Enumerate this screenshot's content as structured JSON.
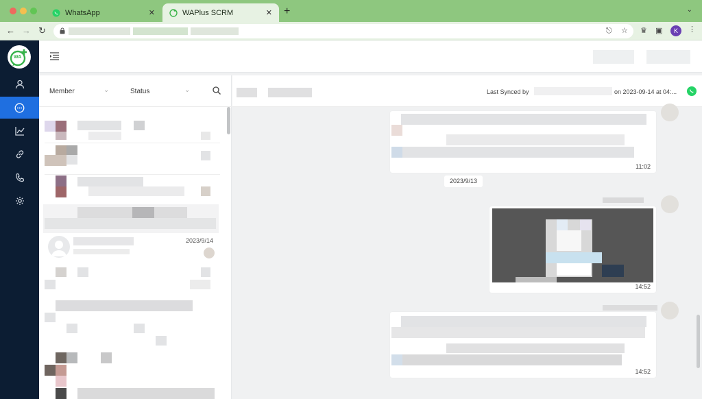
{
  "browser": {
    "tabs": [
      {
        "label": "WhatsApp",
        "active": false
      },
      {
        "label": "WAPlus SCRM",
        "active": true
      }
    ],
    "new_tab": "+",
    "close_glyph": "✕",
    "profile_initial": "K"
  },
  "app": {
    "sidebar": {
      "items": [
        {
          "icon": "user-icon",
          "active": false
        },
        {
          "icon": "chat-icon",
          "active": true
        },
        {
          "icon": "chart-icon",
          "active": false
        },
        {
          "icon": "link-icon",
          "active": false
        },
        {
          "icon": "phone-icon",
          "active": false
        },
        {
          "icon": "gear-icon",
          "active": false
        }
      ],
      "logo_text": "WA"
    },
    "filters": {
      "member_label": "Member",
      "status_label": "Status"
    },
    "contact": {
      "date": "2023/9/14"
    },
    "chat": {
      "last_synced_prefix": "Last Synced by",
      "last_synced_suffix": "on 2023-09-14 at 04:...",
      "date_divider": "2023/9/13",
      "times": [
        "11:02",
        "14:52",
        "14:52"
      ]
    }
  },
  "colors": {
    "sidebar": "#0c1d33",
    "active_nav": "#1f6fe0",
    "browser_chrome": "#8ec77f",
    "whatsapp_green": "#25d366"
  }
}
